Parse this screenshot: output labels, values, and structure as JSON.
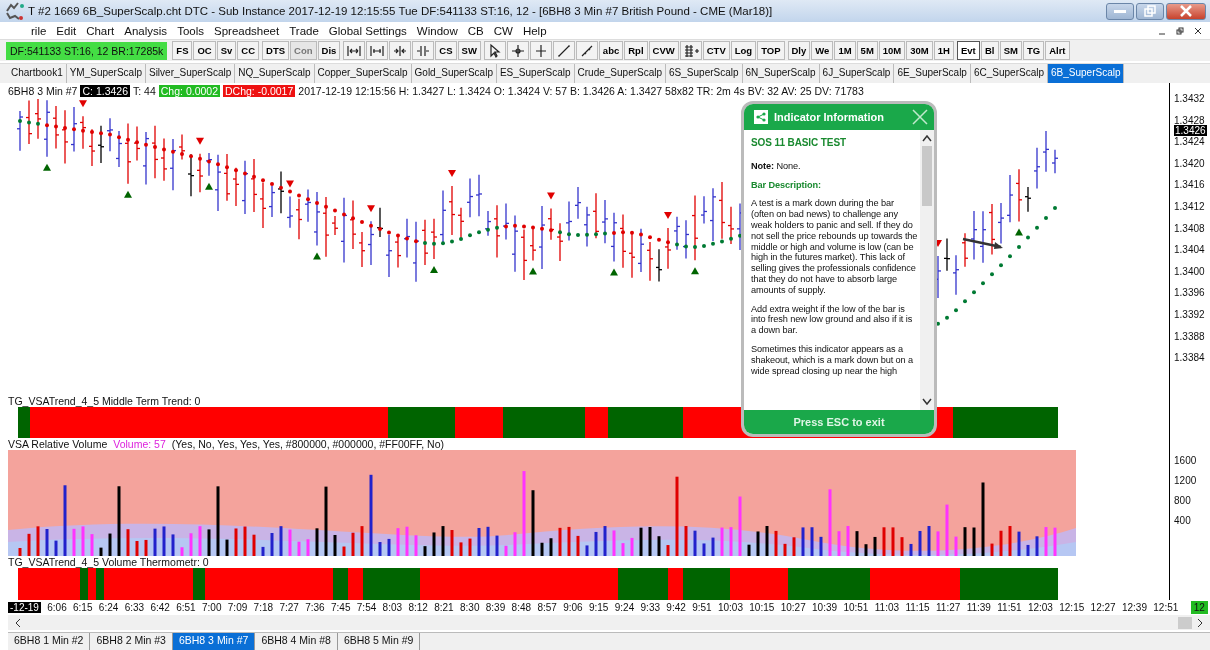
{
  "window": {
    "title": "T #2 1669 6B_SuperScalp.cht  DTC - Sub Instance 2017-12-19  12:15:55 Tue  DF:541133  ST:16, 12 - [6BH8  3 Min   #7  British Pound - CME (Mar18)]"
  },
  "menu": [
    "rile",
    "Edit",
    "Chart",
    "Analysis",
    "Tools",
    "Spreadsheet",
    "Trade",
    "Global Settings",
    "Window",
    "CB",
    "CW",
    "Help"
  ],
  "status_box": "DF:541133  ST:16, 12  BR:17285k",
  "toolbar": [
    [
      {
        "kind": "text",
        "label": "FS",
        "pressed": false,
        "disabled": false
      },
      {
        "kind": "text",
        "label": "OC",
        "pressed": false,
        "disabled": false
      },
      {
        "kind": "text",
        "label": "Sv",
        "pressed": false,
        "disabled": false
      },
      {
        "kind": "text",
        "label": "CC",
        "pressed": false,
        "disabled": false
      }
    ],
    [
      {
        "kind": "text",
        "label": "DTS",
        "pressed": false,
        "disabled": false
      },
      {
        "kind": "text",
        "label": "Con",
        "pressed": false,
        "disabled": true
      },
      {
        "kind": "text",
        "label": "Dis",
        "pressed": false,
        "disabled": false
      }
    ],
    [
      {
        "kind": "icon",
        "pressed": false,
        "disabled": false
      },
      {
        "kind": "icon",
        "pressed": false,
        "disabled": false
      },
      {
        "kind": "icon",
        "pressed": false,
        "disabled": false
      },
      {
        "kind": "icon",
        "pressed": false,
        "disabled": false
      },
      {
        "kind": "text",
        "label": "CS",
        "pressed": false,
        "disabled": false
      },
      {
        "kind": "text",
        "label": "SW",
        "pressed": false,
        "disabled": false
      }
    ],
    [
      {
        "kind": "icon",
        "pressed": false,
        "disabled": false
      },
      {
        "kind": "icon",
        "pressed": false,
        "disabled": false
      },
      {
        "kind": "icon",
        "pressed": false,
        "disabled": false
      },
      {
        "kind": "icon",
        "pressed": false,
        "disabled": false
      },
      {
        "kind": "icon",
        "pressed": false,
        "disabled": false
      },
      {
        "kind": "text",
        "label": "abc",
        "pressed": false,
        "disabled": false
      },
      {
        "kind": "text",
        "label": "Rpl",
        "pressed": false,
        "disabled": false
      },
      {
        "kind": "text",
        "label": "CVW",
        "pressed": false,
        "disabled": false
      },
      {
        "kind": "icon",
        "pressed": false,
        "disabled": false
      },
      {
        "kind": "text",
        "label": "CTV",
        "pressed": false,
        "disabled": false
      },
      {
        "kind": "text",
        "label": "Log",
        "pressed": false,
        "disabled": false
      },
      {
        "kind": "text",
        "label": "TOP",
        "pressed": false,
        "disabled": false
      }
    ],
    [
      {
        "kind": "text",
        "label": "Dly",
        "pressed": false,
        "disabled": false
      },
      {
        "kind": "text",
        "label": "We",
        "pressed": false,
        "disabled": false
      },
      {
        "kind": "text",
        "label": "1M",
        "pressed": false,
        "disabled": false
      },
      {
        "kind": "text",
        "label": "5M",
        "pressed": false,
        "disabled": false
      },
      {
        "kind": "text",
        "label": "10M",
        "pressed": false,
        "disabled": false
      },
      {
        "kind": "text",
        "label": "30M",
        "pressed": false,
        "disabled": false
      },
      {
        "kind": "text",
        "label": "1H",
        "pressed": false,
        "disabled": false
      }
    ],
    [
      {
        "kind": "text",
        "label": "Evt",
        "pressed": true,
        "disabled": false
      },
      {
        "kind": "text",
        "label": "Bl",
        "pressed": false,
        "disabled": false
      },
      {
        "kind": "text",
        "label": "SM",
        "pressed": false,
        "disabled": false
      },
      {
        "kind": "text",
        "label": "TG",
        "pressed": false,
        "disabled": false
      },
      {
        "kind": "text",
        "label": "Alrt",
        "pressed": false,
        "disabled": false
      }
    ]
  ],
  "tabs": [
    {
      "label": "Chartbook1",
      "selected": false
    },
    {
      "label": "YM_SuperScalp",
      "selected": false
    },
    {
      "label": "Silver_SuperScalp",
      "selected": false
    },
    {
      "label": "NQ_SuperScalp",
      "selected": false
    },
    {
      "label": "Copper_SuperScalp",
      "selected": false
    },
    {
      "label": "Gold_SuperScalp",
      "selected": false
    },
    {
      "label": "ES_SuperScalp",
      "selected": false
    },
    {
      "label": "Crude_SuperScalp",
      "selected": false
    },
    {
      "label": "6S_SuperScalp",
      "selected": false
    },
    {
      "label": "6N_SuperScalp",
      "selected": false
    },
    {
      "label": "6J_SuperScalp",
      "selected": false
    },
    {
      "label": "6E_SuperScalp",
      "selected": false
    },
    {
      "label": "6C_SuperScalp",
      "selected": false
    },
    {
      "label": "6B_SuperScalp",
      "selected": true
    }
  ],
  "symbol_info": {
    "symbol": "6BH8  3 Min   #7",
    "close": "C: 1.3426",
    "ticks": "T: 44",
    "change": "Chg: 0.0002",
    "daily_change": "DChg: -0.0017",
    "details": "2017-12-19 12:15:56 H: 1.3427 L: 1.3424 O: 1.3424 V: 57 B: 1.3426 A: 1.3427 58x82 TR: 2m 4s BV: 32 AV: 25 DV: 71783"
  },
  "price_axis": {
    "labels": [
      "1.3432",
      "1.3428",
      "1.3424",
      "1.3420",
      "1.3416",
      "1.3412",
      "1.3408",
      "1.3404",
      "1.3400",
      "1.3396",
      "1.3392",
      "1.3388",
      "1.3384"
    ],
    "current": "1.3426"
  },
  "popup": {
    "title": "Indicator Information",
    "heading": "SOS 11 BASIC TEST",
    "note": "**Note:** None.",
    "section": "Bar Description:",
    "paragraphs": [
      "A test is a mark down during the bar (often on bad news) to challenge any weak holders to panic and sell. If they do not sell the price rebounds up towards the middle or high and volume is low (can be high in the futures market). This lack of selling gives the professionals confidence that they do not have to absorb large amounts of supply.",
      "Add extra weight if the low of the bar is into fresh new low ground and also if it is a down bar.",
      "Sometimes this indicator appears as a shakeout, which is a mark down but on a wide spread closing up near the high"
    ],
    "footer": "Press ESC to exit"
  },
  "trend_panel": {
    "label": "TG_VSATrend_4_5  Middle Term Trend: 0"
  },
  "volume_panel": {
    "name": "VSA Relative Volume",
    "volume": "Volume: 57",
    "params": "(Yes, No, Yes, Yes, Yes, #800000, #000000, #FF00FF, No)",
    "axis": [
      "1600",
      "1200",
      "800",
      "400"
    ]
  },
  "thermometer_panel": {
    "label": "TG_VSATrend_4_5  Volume Thermometr: 0"
  },
  "time_axis": {
    "start": "-12-19",
    "labels": [
      "6:06",
      "6:15",
      "6:24",
      "6:33",
      "6:42",
      "6:51",
      "7:00",
      "7:09",
      "7:18",
      "7:27",
      "7:36",
      "7:45",
      "7:54",
      "8:03",
      "8:12",
      "8:21",
      "8:30",
      "8:39",
      "8:48",
      "8:57",
      "9:06",
      "9:15",
      "9:24",
      "9:33",
      "9:42",
      "9:51",
      "10:03",
      "10:15",
      "10:27",
      "10:39",
      "10:51",
      "11:03",
      "11:15",
      "11:27",
      "11:39",
      "11:51",
      "12:03",
      "12:15",
      "12:27",
      "12:39",
      "12:51"
    ],
    "badge": "12"
  },
  "bottom_tabs": [
    {
      "label": "6BH8  1 Min   #2",
      "selected": false
    },
    {
      "label": "6BH8  2 Min   #3",
      "selected": false
    },
    {
      "label": "6BH8  3 Min   #7",
      "selected": true
    },
    {
      "label": "6BH8  4 Min   #8",
      "selected": false
    },
    {
      "label": "6BH8  5 Min   #9",
      "selected": false
    }
  ]
}
